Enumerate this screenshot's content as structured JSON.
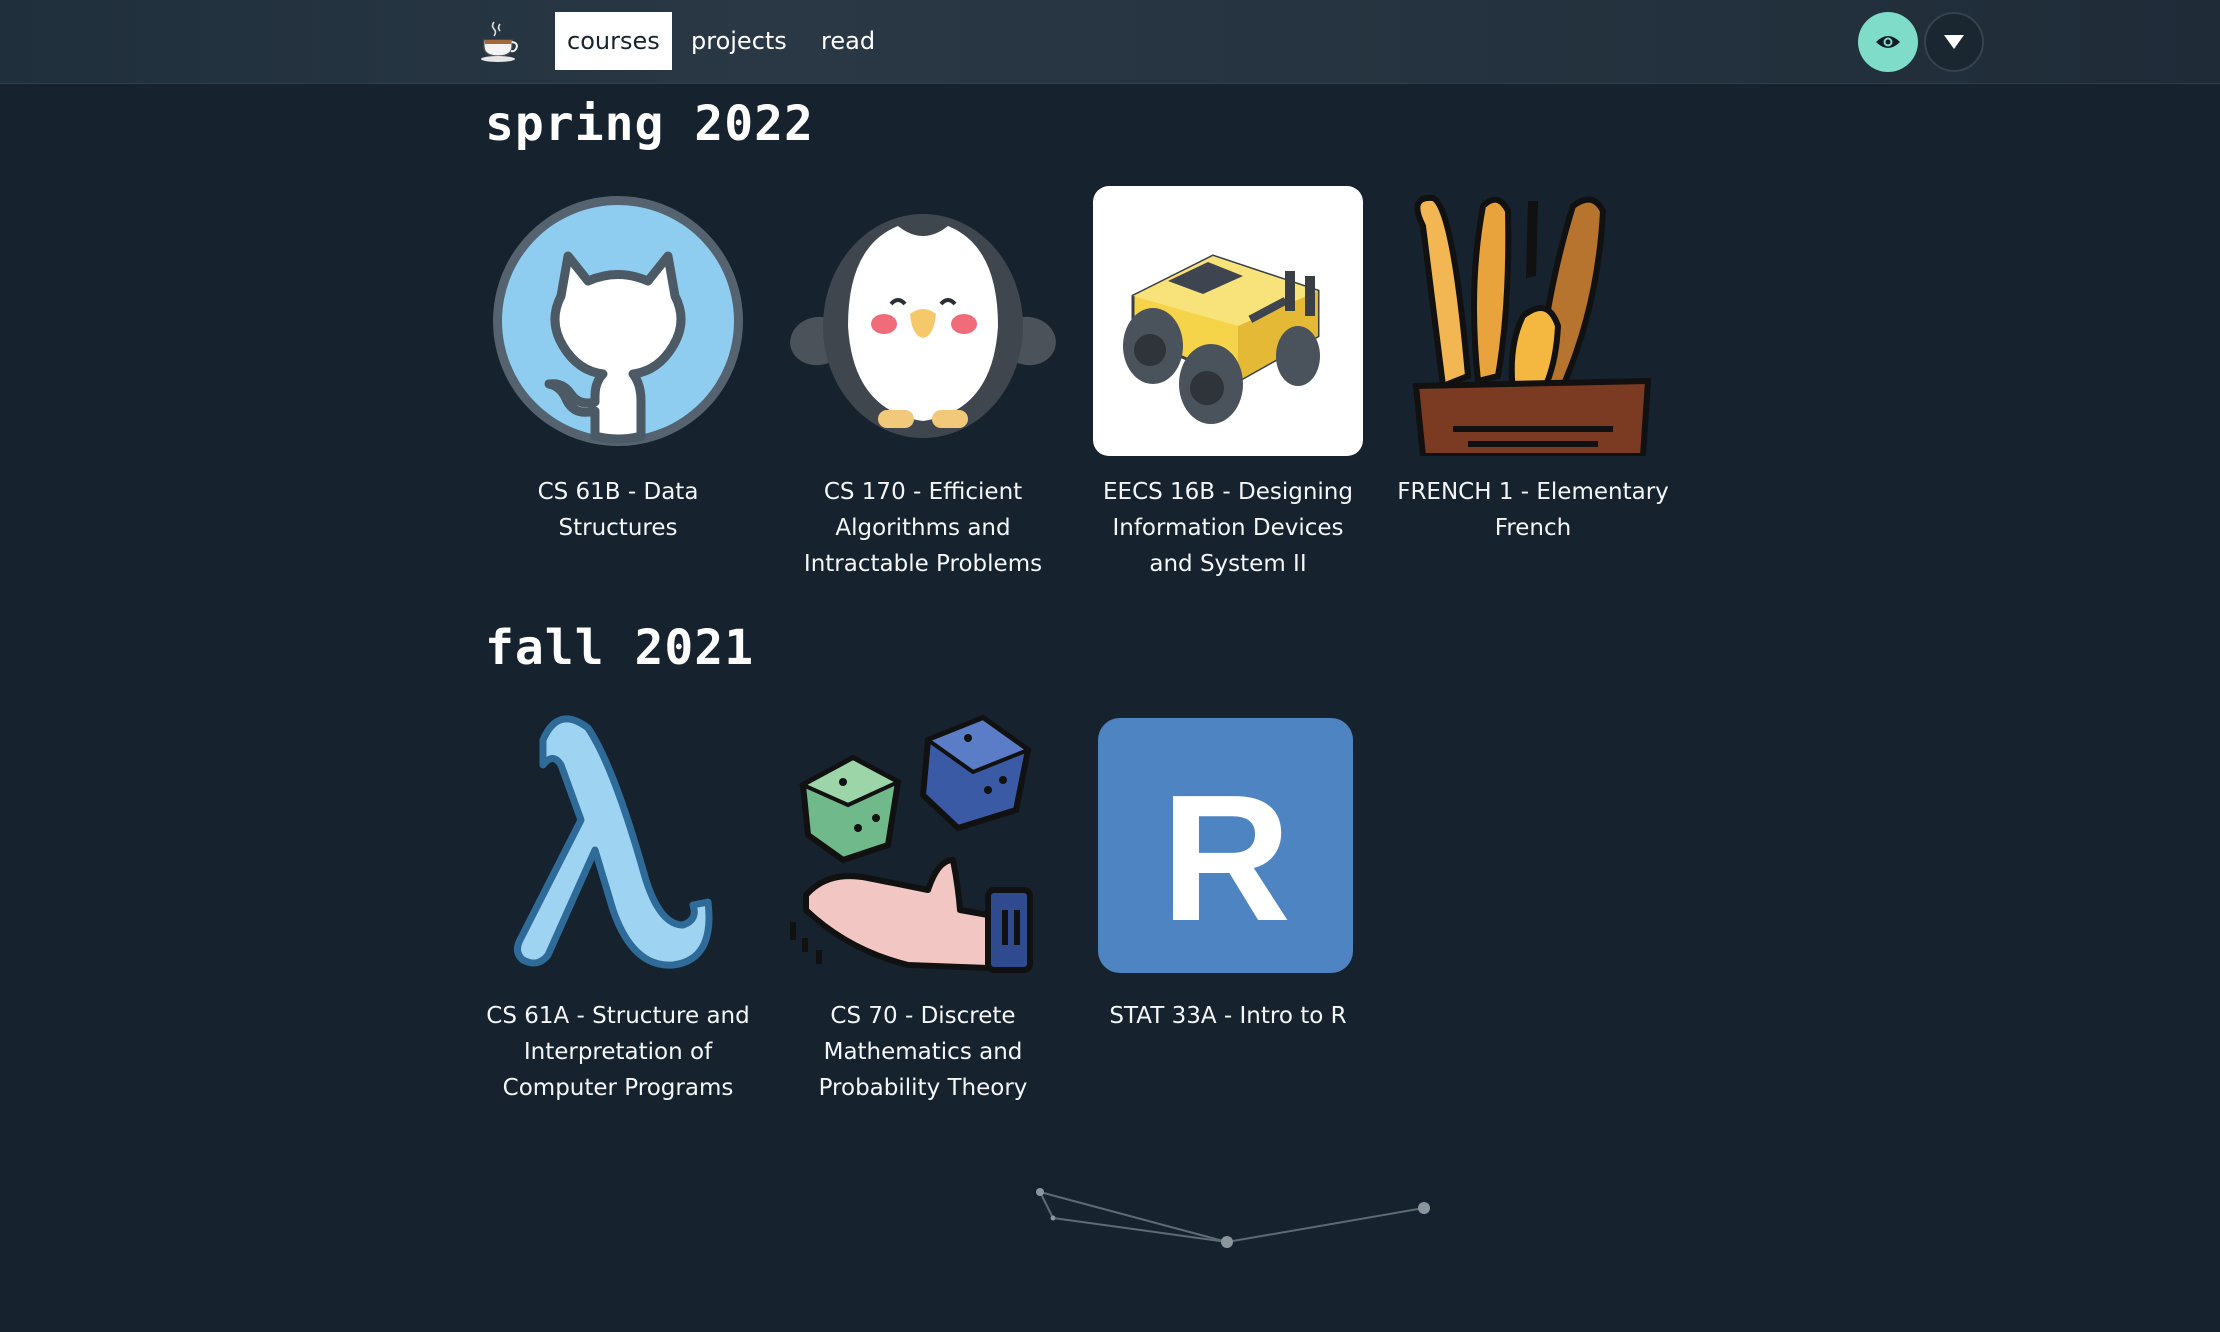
{
  "nav": {
    "logo_icon": "coffee-cup-icon",
    "links": [
      "courses",
      "projects",
      "read"
    ],
    "active": "courses",
    "theme_toggle_icon": "eye-icon",
    "menu_icon": "triangle-down-icon",
    "accent": "#7fdcc9"
  },
  "sections": [
    {
      "title": "spring 2022",
      "courses": [
        {
          "label": "CS 61B - Data Structures",
          "icon": "github-octocat-icon"
        },
        {
          "label": "CS 170 - Efficient Algorithms and Intractable Problems",
          "icon": "penguin-icon"
        },
        {
          "label": "EECS 16B - Designing Information Devices and System II",
          "icon": "robot-car-icon"
        },
        {
          "label": "FRENCH 1 - Elementary French",
          "icon": "baguette-basket-icon"
        }
      ]
    },
    {
      "title": "fall 2021",
      "courses": [
        {
          "label": "CS 61A - Structure and Interpretation of Computer Programs",
          "icon": "lambda-icon"
        },
        {
          "label": "CS 70 - Discrete Mathematics and Probability Theory",
          "icon": "dice-hand-icon"
        },
        {
          "label": "STAT 33A - Intro to R",
          "icon": "r-logo-icon"
        }
      ]
    }
  ],
  "r_logo_letter": "R",
  "background": "#16232e"
}
